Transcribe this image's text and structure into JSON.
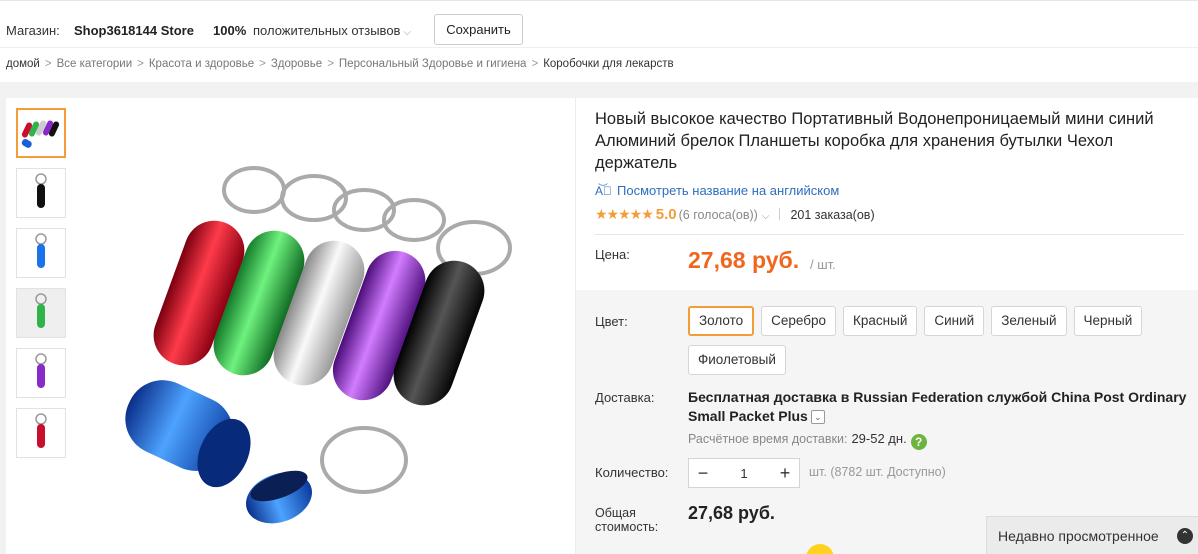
{
  "store": {
    "label": "Магазин:",
    "name": "Shop3618144 Store",
    "positive_pct": "100%",
    "feedback_label": "положительных отзывов",
    "save_button": "Сохранить"
  },
  "breadcrumb": {
    "home": "домой",
    "items": [
      "Все категории",
      "Красота и здоровье",
      "Здоровье",
      "Персональный Здоровье и гигиена"
    ],
    "current": "Коробочки для лекарств",
    "separator": ">"
  },
  "product": {
    "title": "Новый высокое качество Портативный Водонепроницаемый мини синий Алюминий брелок Планшеты коробка для хранения бутылки Чехол держатель",
    "translate_link": "Посмотреть название на английском",
    "rating": {
      "stars": "★★★★★",
      "score": "5.0",
      "votes": "(6 голоса(ов))",
      "orders": "201 заказа(ов)"
    },
    "price_label": "Цена:",
    "price": "27,68 руб.",
    "price_unit": "/ шт.",
    "color_label": "Цвет:",
    "colors": [
      "Золото",
      "Серебро",
      "Красный",
      "Синий",
      "Зеленый",
      "Черный",
      "Фиолетовый"
    ],
    "selected_color": "Золото",
    "delivery_label": "Доставка:",
    "delivery_text": "Бесплатная доставка в Russian Federation службой China Post Ordinary Small Packet Plus",
    "eta_label": "Расчётное время доставки:",
    "eta_days": "29-52 дн.",
    "quantity_label": "Количество:",
    "quantity": "1",
    "availability": "шт. (8782 шт. Доступно)",
    "total_label": "Общая стоимость:",
    "total": "27,68 руб."
  },
  "recently_viewed": "Недавно просмотренное",
  "thumbnails": [
    "multi",
    "black",
    "blue",
    "green",
    "purple",
    "red"
  ],
  "colors_theme": {
    "accent": "#f29d38",
    "price": "#f0661e",
    "link": "#2e6ec1"
  }
}
